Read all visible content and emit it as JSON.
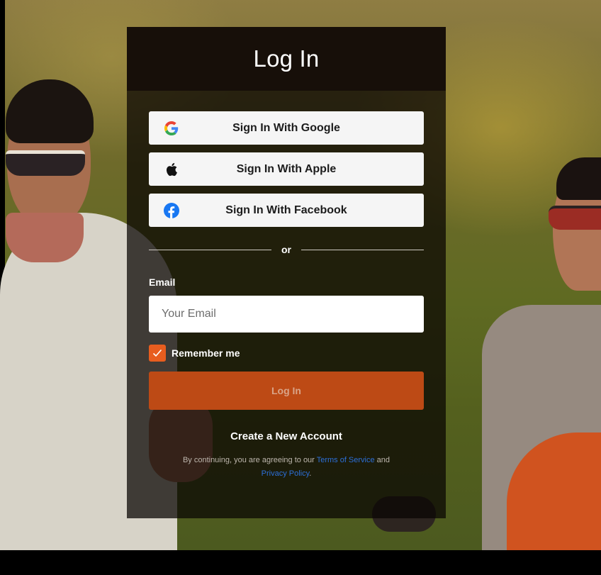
{
  "panel": {
    "title": "Log In"
  },
  "social": [
    {
      "label": "Sign In With Google",
      "icon": "google-icon"
    },
    {
      "label": "Sign In With Apple",
      "icon": "apple-icon"
    },
    {
      "label": "Sign In With Facebook",
      "icon": "facebook-icon"
    }
  ],
  "divider": {
    "text": "or"
  },
  "email": {
    "label": "Email",
    "placeholder": "Your Email",
    "value": ""
  },
  "remember": {
    "label": "Remember me",
    "checked": true
  },
  "login_button": {
    "label": "Log In"
  },
  "create_account": {
    "label": "Create a New Account"
  },
  "terms": {
    "prefix": "By continuing, you are agreeing to our ",
    "terms_link": "Terms of Service",
    "middle": " and ",
    "privacy_link": "Privacy Policy",
    "suffix": "."
  },
  "colors": {
    "accent": "#e85d1f",
    "login_button": "#bd4a15",
    "link": "#2c6fd8",
    "panel_header": "#170f09"
  }
}
